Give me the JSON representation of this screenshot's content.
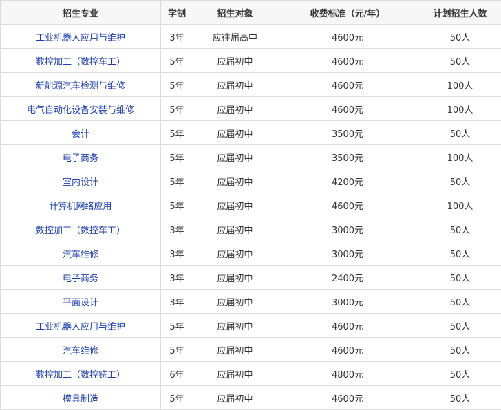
{
  "table": {
    "headers": [
      "招生专业",
      "学制",
      "招生对象",
      "收费标准（元/年）",
      "计划招生人数"
    ],
    "rows": [
      [
        "工业机器人应用与维护",
        "3年",
        "应往届高中",
        "4600元",
        "50人"
      ],
      [
        "数控加工（数控车工）",
        "5年",
        "应届初中",
        "4600元",
        "50人"
      ],
      [
        "新能源汽车检测与维修",
        "5年",
        "应届初中",
        "4600元",
        "100人"
      ],
      [
        "电气自动化设备安装与维修",
        "5年",
        "应届初中",
        "4600元",
        "100人"
      ],
      [
        "会计",
        "5年",
        "应届初中",
        "3500元",
        "50人"
      ],
      [
        "电子商务",
        "5年",
        "应届初中",
        "3500元",
        "100人"
      ],
      [
        "室内设计",
        "5年",
        "应届初中",
        "4200元",
        "50人"
      ],
      [
        "计算机网络应用",
        "5年",
        "应届初中",
        "4600元",
        "100人"
      ],
      [
        "数控加工（数控车工）",
        "3年",
        "应届初中",
        "3000元",
        "50人"
      ],
      [
        "汽车维修",
        "3年",
        "应届初中",
        "3000元",
        "50人"
      ],
      [
        "电子商务",
        "3年",
        "应届初中",
        "2400元",
        "50人"
      ],
      [
        "平面设计",
        "3年",
        "应届初中",
        "3000元",
        "50人"
      ],
      [
        "工业机器人应用与维护",
        "5年",
        "应届初中",
        "4600元",
        "50人"
      ],
      [
        "汽车维修",
        "5年",
        "应届初中",
        "4600元",
        "50人"
      ],
      [
        "数控加工（数控铣工）",
        "6年",
        "应届初中",
        "4800元",
        "50人"
      ],
      [
        "模具制造",
        "5年",
        "应届初中",
        "4600元",
        "50人"
      ]
    ]
  },
  "colors": {
    "major_link": "#1e3fb4",
    "header_bg": "#f7f7f7",
    "border": "#dcdcdc"
  }
}
